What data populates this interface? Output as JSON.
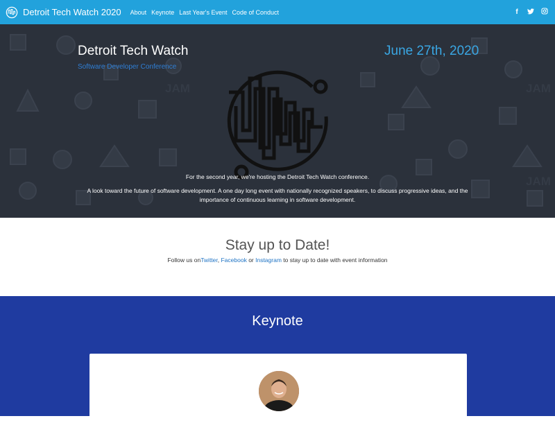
{
  "navbar": {
    "brand": "Detroit Tech Watch 2020",
    "links": [
      "About",
      "Keynote",
      "Last Year's Event",
      "Code of Conduct"
    ],
    "social": [
      {
        "name": "facebook-icon",
        "glyph": "f"
      },
      {
        "name": "twitter-icon",
        "glyph": "🐦"
      },
      {
        "name": "instagram-icon",
        "glyph": "◎"
      }
    ],
    "color": "#22a2dc"
  },
  "hero": {
    "title": "Detroit Tech Watch",
    "subtitle": "Software Developer Conference",
    "date": "June 27th, 2020",
    "paragraph1": "For the second year, we're hosting the Detroit Tech Watch conference.",
    "paragraph2": "A look toward the future of software development. A one day long event with nationally recognized speakers, to discuss progressive ideas, and the importance of continuous learning in software development.",
    "background_color": "#2b313b",
    "date_color": "#3aa7e4"
  },
  "stay": {
    "title": "Stay up to Date!",
    "text_before": "Follow us on",
    "twitter": "Twitter",
    "sep1": ", ",
    "facebook": "Facebook",
    "sep2": " or ",
    "instagram": "Instagram",
    "text_after": " to stay up to date with event information"
  },
  "keynote": {
    "title": "Keynote",
    "background_color": "#1f3ba0"
  }
}
